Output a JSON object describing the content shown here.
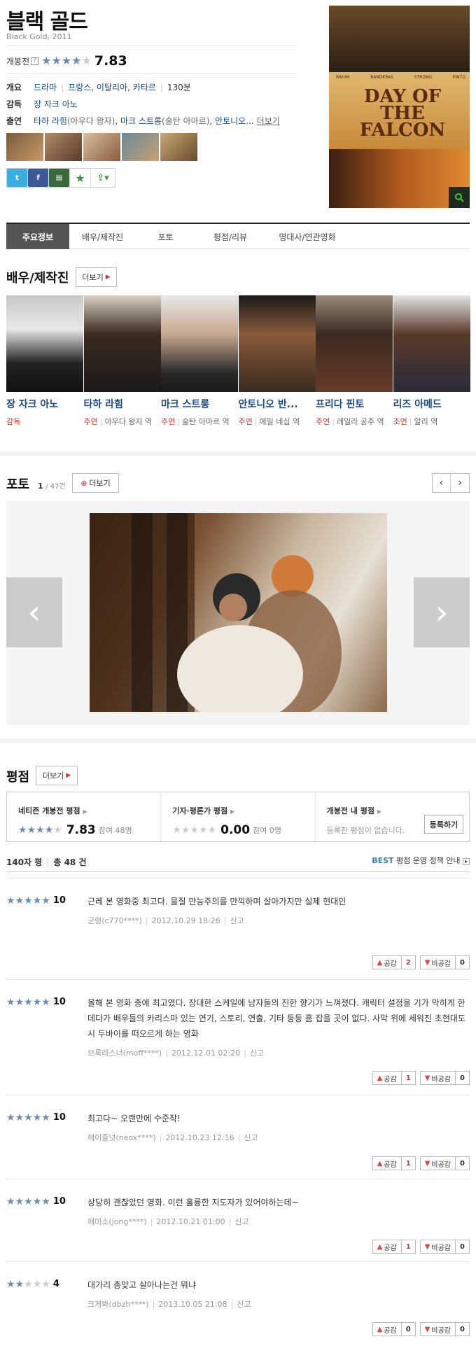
{
  "movie": {
    "title": "블랙 골드",
    "subtitle": "Black Gold, 2011",
    "rating_label": "개봉전",
    "rating_help": "?",
    "score": "7.83",
    "stars": 4,
    "genre_label": "개요",
    "genre": "드라마",
    "countries": "프랑스, 이탈리아, 카타르",
    "runtime": "130분",
    "director_label": "감독",
    "director": "장 자크 아노",
    "cast_label": "출연",
    "cast_1": "타하 라힘",
    "cast_1_role": "(아우다 왕자)",
    "cast_2": "마크 스트롱",
    "cast_2_role": "(술탄 아마르)",
    "cast_3": "안토니오...",
    "cast_more": "더보기",
    "poster_title": "DAY OF THE FALCON",
    "poster_cast": [
      "RAHIM",
      "BANDERAS",
      "STRONG",
      "PINTO"
    ]
  },
  "share": [
    "twitter-icon",
    "facebook-icon",
    "me2day-icon",
    "yozm-icon",
    "share-more-icon"
  ],
  "tabs": [
    "주요정보",
    "배우/제작진",
    "포토",
    "평점/리뷰",
    "명대사/연관영화"
  ],
  "cast_section": {
    "title": "배우/제작진",
    "more": "더보기",
    "people": [
      {
        "name": "장 자크 아노",
        "role": "감독",
        "part": ""
      },
      {
        "name": "타하 라힘",
        "role": "주연",
        "part": "아우다 왕자 역"
      },
      {
        "name": "마크 스트롱",
        "role": "주연",
        "part": "술탄 아마르 역"
      },
      {
        "name": "안토니오 반...",
        "role": "주연",
        "part": "에밀 네십 역"
      },
      {
        "name": "프리다 핀토",
        "role": "주연",
        "part": "레일라 공주 역"
      },
      {
        "name": "리즈 아메드",
        "role": "조연",
        "part": "알리 역"
      }
    ]
  },
  "photo_section": {
    "title": "포토",
    "current": "1",
    "total": "/ 47건",
    "more": "더보기"
  },
  "rating_section": {
    "title": "평점",
    "more": "더보기",
    "netizen_label": "네티즌 개봉전 평점",
    "netizen_score": "7.83",
    "netizen_count": "참여 48명",
    "critic_label": "기자·평론가 평점",
    "critic_score": "0.00",
    "critic_count": "참여 0명",
    "mine_label": "개봉전 내 평점",
    "mine_note": "등록한 평점이 없습니다.",
    "register": "등록하기",
    "list_label": "140자 평",
    "total": "총 48 건",
    "best_prefix": "BEST",
    "best_text": "평점 운영 정책 안내"
  },
  "reviews": [
    {
      "score": "10",
      "stars": 5,
      "text": "근레 본 영화중 최고다. 물질 만능주의를 만끽하며 살아가지만 실제 현대인",
      "user": "군령(c770****)",
      "date": "2012.10.29 18:26",
      "report": "신고",
      "like": "2",
      "dislike": "0"
    },
    {
      "score": "10",
      "stars": 5,
      "text": "올해 본 영화 중에 최고였다. 장대한 스케일에 남자들의 진한 향기가 느껴졌다. 캐릭터 설정을 기가 막히게 한데다가 배우들의 카리스마 있는 연기, 스토리, 연출, 기타 등등 흠 잡을 곳이 없다. 사막 위에 세워진 초현대도시 두바이를 떠오르게 하는 영화",
      "user": "브록레스너(moff****)",
      "date": "2012.12.01 02:20",
      "report": "신고",
      "like": "1",
      "dislike": "0"
    },
    {
      "score": "10",
      "stars": 5,
      "text": "최고다~ 오랜만에 수준작!",
      "user": "헤이즐넛(neox****)",
      "date": "2012.10.23 12:16",
      "report": "신고",
      "like": "1",
      "dislike": "0"
    },
    {
      "score": "10",
      "stars": 5,
      "text": "상당히 괜찮았던 영화. 이런 훌륭한 지도자가 있어야하는데~",
      "user": "해미소(jong****)",
      "date": "2012.10.21 01:00",
      "report": "신고",
      "like": "1",
      "dislike": "0"
    },
    {
      "score": "4",
      "stars": 2,
      "text": "대가리 총맞고 살아나는건 뭐냐",
      "user": "크게봐(dbzh****)",
      "date": "2013.10.05 21:08",
      "report": "신고",
      "like": "0",
      "dislike": "0"
    }
  ],
  "vote_labels": {
    "like": "공감",
    "dislike": "비공감"
  },
  "colors": {
    "accent": "#1a4a8a",
    "star": "#6b8bb5",
    "red": "#d33",
    "tab_active": "#555"
  }
}
